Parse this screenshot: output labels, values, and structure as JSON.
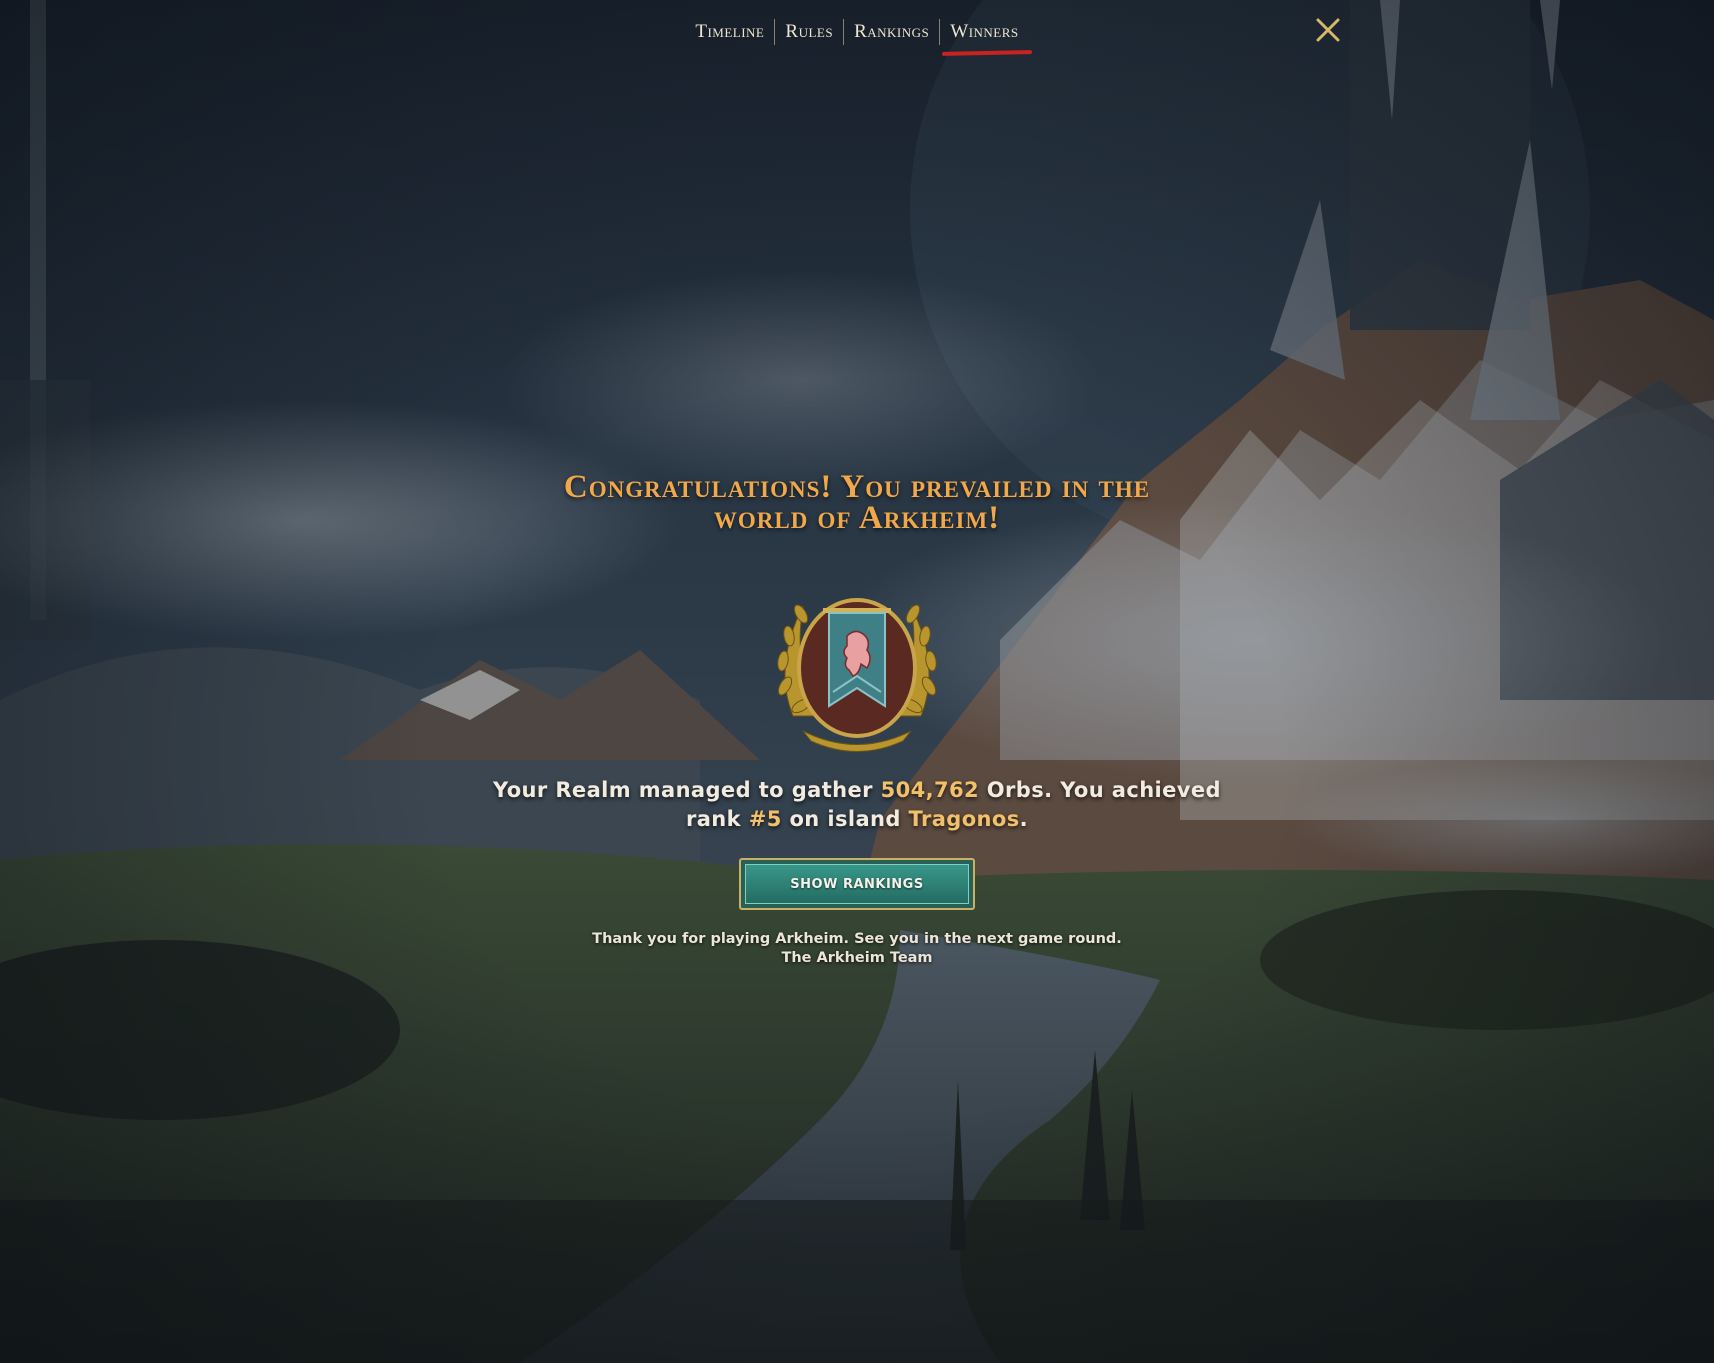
{
  "nav": {
    "tabs": [
      {
        "label": "Timeline"
      },
      {
        "label": "Rules"
      },
      {
        "label": "Rankings"
      },
      {
        "label": "Winners"
      }
    ],
    "active_tab": "Winners"
  },
  "close_icon": "close-icon",
  "content": {
    "headline_line1": "Congratulations! You prevailed in the",
    "headline_line2": "world of Arkheim!",
    "emblem_icon": "laurel-banner-lion-emblem",
    "summary": {
      "part1": "Your Realm managed to gather ",
      "orbs": "504,762",
      "part2": " Orbs. You achieved",
      "part3": "rank ",
      "rank": "#5",
      "part4": " on island ",
      "island": "Tragonos",
      "part5": "."
    },
    "show_rankings_label": "SHOW RANKINGS",
    "thanks_line1": "Thank you for playing Arkheim. See you in the next game round.",
    "thanks_line2": "The Arkheim Team"
  },
  "colors": {
    "accent_gold": "#f0a84a",
    "highlight": "#f2c06a",
    "button_teal": "#2c7d72",
    "active_underline": "#c8231f"
  }
}
